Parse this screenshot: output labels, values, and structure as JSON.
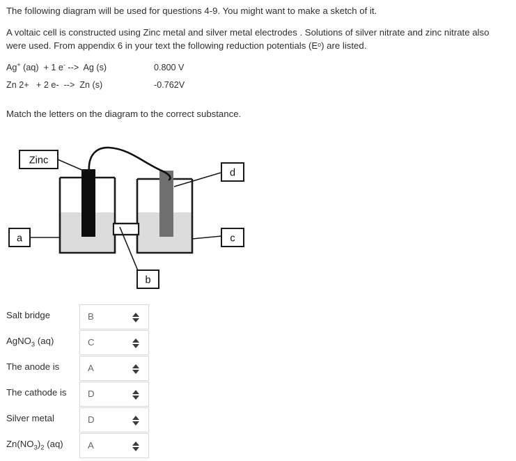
{
  "question": {
    "intro": "The following diagram will be used for questions 4-9. You might want to make a sketch of it.",
    "body": "A voltaic cell is constructed using Zinc metal and silver metal electrodes . Solutions of silver nitrate and zinc nitrate also were used. From appendix 6 in your text the following reduction potentials (Eᵒ) are listed.",
    "equations": [
      {
        "reaction_pre": "Ag",
        "charge": "+",
        "reaction_post": " (aq)  + 1 e",
        "electron_charge": "-",
        "reaction_tail": " -->  Ag (s)",
        "potential": "0.800 V"
      },
      {
        "reaction_pre": "Zn 2+",
        "charge": "",
        "reaction_post": "   + 2 e-  -->  Zn (s)",
        "electron_charge": "",
        "reaction_tail": "",
        "potential": "-0.762V"
      }
    ],
    "instruction": "Match the letters on the diagram to the correct substance."
  },
  "diagram": {
    "callouts": {
      "zinc": "Zinc",
      "a": "a",
      "b": "b",
      "c": "c",
      "d": "d"
    },
    "colors": {
      "left_electrode": "#0d0d0d",
      "right_electrode": "#707070",
      "solution": "#dcdcdc",
      "outline": "#1a1a1a",
      "wire": "#111111"
    }
  },
  "match_list": {
    "rows": [
      {
        "label": "Salt bridge",
        "value": "B"
      },
      {
        "label": "AgNO3 (aq)",
        "label_base": "AgNO",
        "label_sub": "3",
        "label_tail": " (aq)",
        "value": "C"
      },
      {
        "label": "The anode is",
        "value": "A"
      },
      {
        "label": "The cathode is",
        "value": "D"
      },
      {
        "label": "Silver metal",
        "value": "D"
      },
      {
        "label": "Zn(NO3)2 (aq)",
        "value": "A"
      }
    ],
    "options": [
      "A",
      "B",
      "C",
      "D"
    ]
  }
}
